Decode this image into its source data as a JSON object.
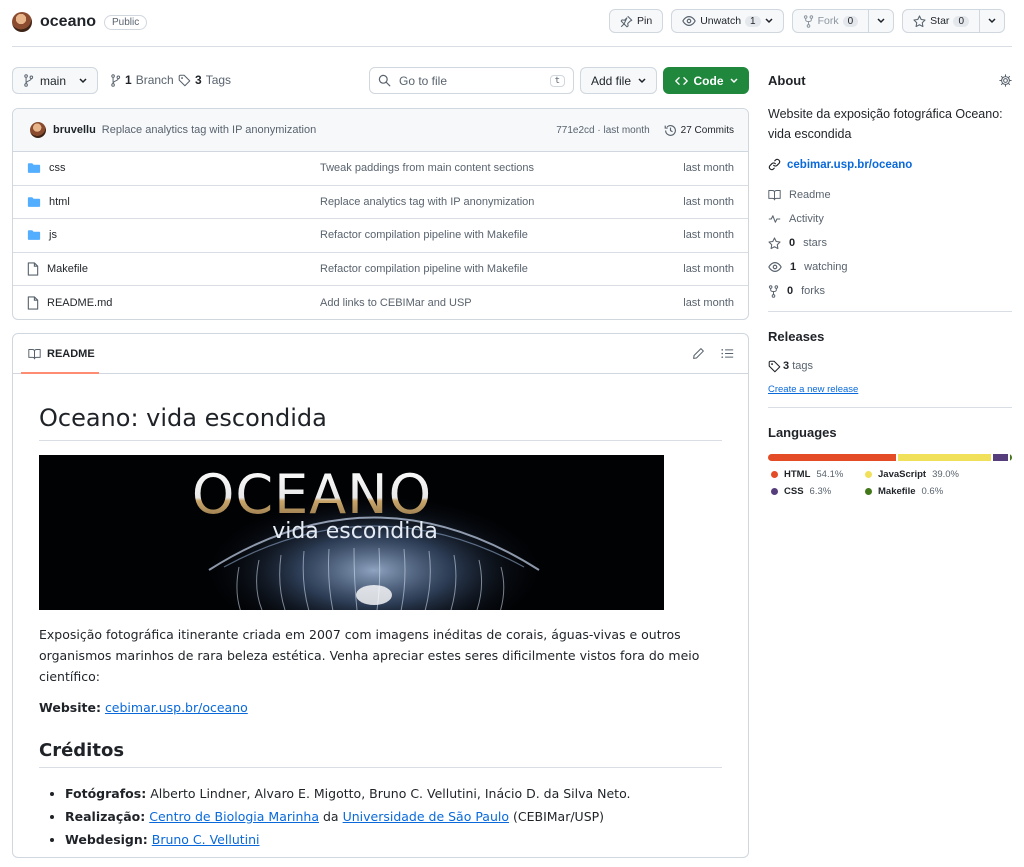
{
  "repo": {
    "name": "oceano",
    "visibility": "Public"
  },
  "actions": {
    "pin": "Pin",
    "unwatch": "Unwatch",
    "watch_count": "1",
    "fork": "Fork",
    "fork_count": "0",
    "star": "Star",
    "star_count": "0"
  },
  "branchbar": {
    "branch": "main",
    "branches_count": "1",
    "branches_label": "Branch",
    "tags_count": "3",
    "tags_label": "Tags",
    "search_placeholder": "Go to file",
    "search_key": "t",
    "add_file": "Add file",
    "code": "Code"
  },
  "commit": {
    "author": "bruvellu",
    "message": "Replace analytics tag with IP anonymization",
    "sha_time": "771e2cd · last month",
    "commits": "27 Commits"
  },
  "files": [
    {
      "name": "css",
      "type": "folder",
      "message": "Tweak paddings from main content sections",
      "date": "last month"
    },
    {
      "name": "html",
      "type": "folder",
      "message": "Replace analytics tag with IP anonymization",
      "date": "last month"
    },
    {
      "name": "js",
      "type": "folder",
      "message": "Refactor compilation pipeline with Makefile",
      "date": "last month"
    },
    {
      "name": "Makefile",
      "type": "file",
      "message": "Refactor compilation pipeline with Makefile",
      "date": "last month"
    },
    {
      "name": "README.md",
      "type": "file",
      "message": "Add links to CEBIMar and USP",
      "date": "last month"
    }
  ],
  "readme": {
    "tab": "README",
    "title": "Oceano: vida escondida",
    "banner_title": "OCEANO",
    "banner_sub": "vida escondida",
    "intro": "Exposição fotográfica itinerante criada em 2007 com imagens inéditas de corais, águas-vivas e outros organismos marinhos de rara beleza estética. Venha apreciar estes seres dificilmente vistos fora do meio científico:",
    "website_label": "Website:",
    "website_link": "cebimar.usp.br/oceano",
    "credits_title": "Créditos",
    "credits": {
      "fotografos_label": "Fotógrafos:",
      "fotografos": "Alberto Lindner, Alvaro E. Migotto, Bruno C. Vellutini, Inácio D. da Silva Neto.",
      "realizacao_label": "Realização:",
      "realizacao_link1": "Centro de Biologia Marinha",
      "realizacao_da": "da",
      "realizacao_link2": "Universidade de São Paulo",
      "realizacao_suffix": "(CEBIMar/USP)",
      "webdesign_label": "Webdesign:",
      "webdesign_link": "Bruno C. Vellutini"
    }
  },
  "about": {
    "title": "About",
    "description": "Website da exposição fotográfica Oceano: vida escondida",
    "website": "cebimar.usp.br/oceano",
    "readme": "Readme",
    "activity": "Activity",
    "stars_count": "0",
    "stars_label": "stars",
    "watching_count": "1",
    "watching_label": "watching",
    "forks_count": "0",
    "forks_label": "forks"
  },
  "releases": {
    "title": "Releases",
    "tags_count": "3",
    "tags_label": "tags",
    "create_link": "Create a new release"
  },
  "languages": {
    "title": "Languages",
    "items": [
      {
        "name": "HTML",
        "pct": "54.1%",
        "value": 54.1,
        "color": "#e34c26"
      },
      {
        "name": "JavaScript",
        "pct": "39.0%",
        "value": 39.0,
        "color": "#f1e05a"
      },
      {
        "name": "CSS",
        "pct": "6.3%",
        "value": 6.3,
        "color": "#563d7c"
      },
      {
        "name": "Makefile",
        "pct": "0.6%",
        "value": 0.6,
        "color": "#427819"
      }
    ]
  }
}
